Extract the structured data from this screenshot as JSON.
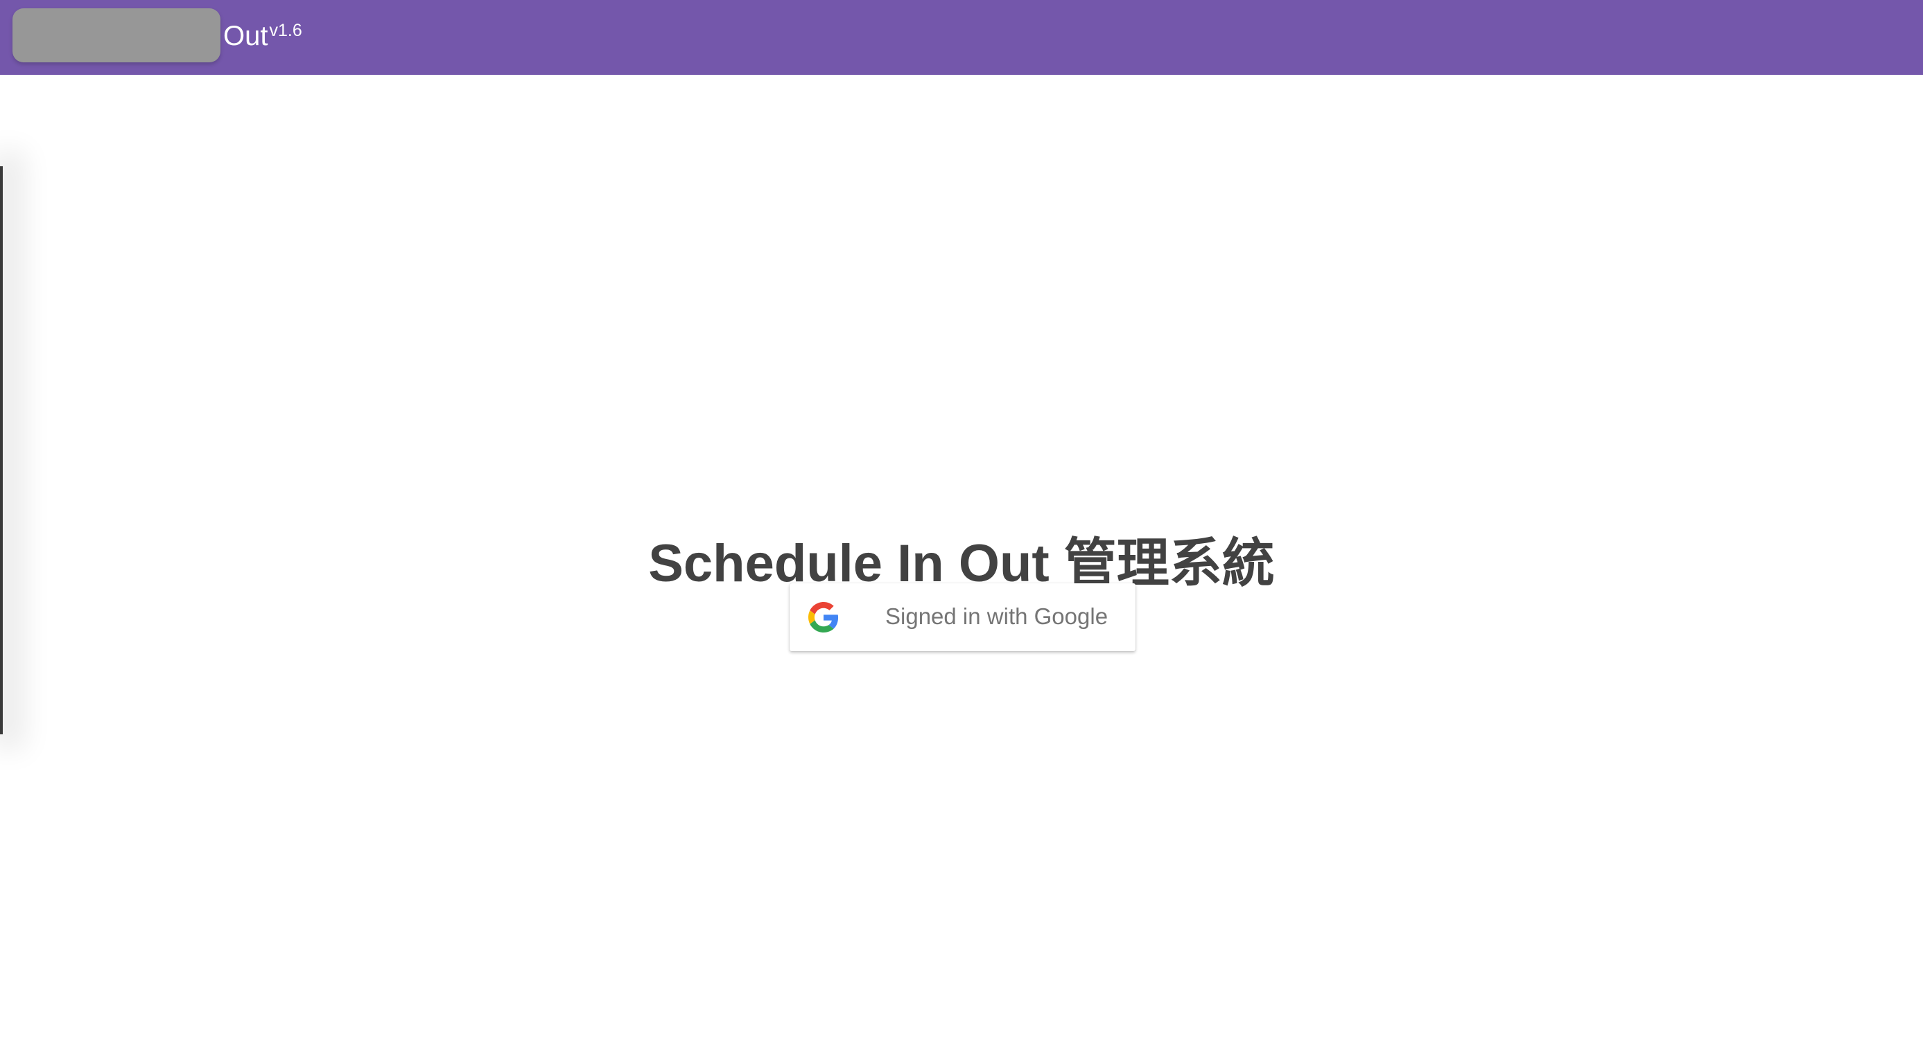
{
  "header": {
    "brand_text": "Out",
    "version": "v1.6",
    "background_color": "#7457ab"
  },
  "main": {
    "title": "Schedule In Out 管理系統",
    "sign_in_button": {
      "label": "Signed in with Google",
      "icon": "google-g-icon"
    }
  }
}
